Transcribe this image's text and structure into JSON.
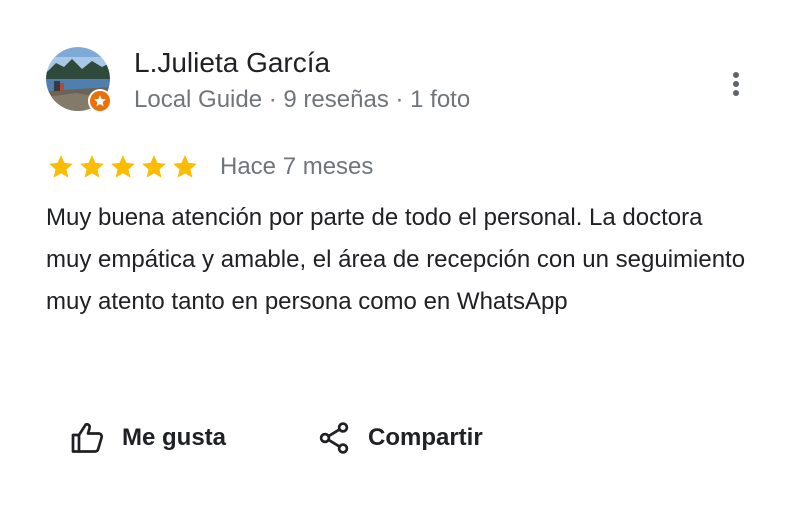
{
  "review": {
    "author": {
      "name": "L.Julieta García",
      "meta": "Local Guide · 9 reseñas · 1 foto",
      "avatar": "landscape-lake-photo",
      "badge_icon": "local-guide-star-badge"
    },
    "rating": {
      "stars": 5,
      "max": 5,
      "date": "Hace 7 meses",
      "star_color": "#fbbc04"
    },
    "text": "Muy buena atención por parte de todo el personal. La doctora muy empática y amable, el área de recepción con un seguimiento muy atento tanto en persona como en WhatsApp",
    "menu_icon": "more-vert-icon"
  },
  "actions": {
    "like_label": "Me gusta",
    "like_icon": "thumbs-up-icon",
    "share_label": "Compartir",
    "share_icon": "share-icon"
  }
}
